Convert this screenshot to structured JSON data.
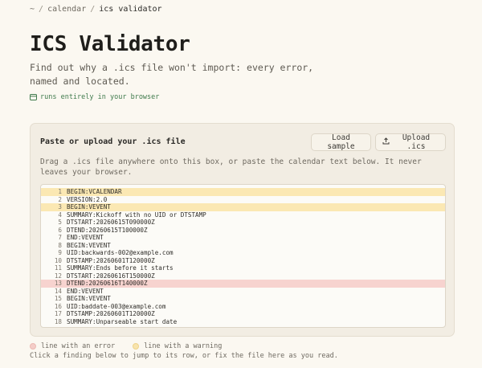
{
  "breadcrumb": {
    "home": "~",
    "section": "calendar",
    "current": "ics validator",
    "separator": "/"
  },
  "header": {
    "title": "ICS Validator",
    "subtitle": "Find out why a .ics file won't import: every error, named and located.",
    "browser_note": "runs entirely in your browser"
  },
  "panel": {
    "title": "Paste or upload your .ics file",
    "load_sample_label": "Load sample",
    "upload_label": "Upload .ics",
    "description": "Drag a .ics file anywhere onto this box, or paste the calendar text below. It never leaves your browser."
  },
  "editor": {
    "lines": [
      {
        "n": "1",
        "text": "BEGIN:VCALENDAR",
        "status": "warning"
      },
      {
        "n": "2",
        "text": "VERSION:2.0",
        "status": ""
      },
      {
        "n": "3",
        "text": "BEGIN:VEVENT",
        "status": "warning"
      },
      {
        "n": "4",
        "text": "SUMMARY:Kickoff with no UID or DTSTAMP",
        "status": ""
      },
      {
        "n": "5",
        "text": "DTSTART:20260615T090000Z",
        "status": ""
      },
      {
        "n": "6",
        "text": "DTEND:20260615T100000Z",
        "status": ""
      },
      {
        "n": "7",
        "text": "END:VEVENT",
        "status": ""
      },
      {
        "n": "8",
        "text": "BEGIN:VEVENT",
        "status": ""
      },
      {
        "n": "9",
        "text": "UID:backwards-002@example.com",
        "status": ""
      },
      {
        "n": "10",
        "text": "DTSTAMP:20260601T120000Z",
        "status": ""
      },
      {
        "n": "11",
        "text": "SUMMARY:Ends before it starts",
        "status": ""
      },
      {
        "n": "12",
        "text": "DTSTART:20260616T150000Z",
        "status": ""
      },
      {
        "n": "13",
        "text": "DTEND:20260616T140000Z",
        "status": "error"
      },
      {
        "n": "14",
        "text": "END:VEVENT",
        "status": ""
      },
      {
        "n": "15",
        "text": "BEGIN:VEVENT",
        "status": ""
      },
      {
        "n": "16",
        "text": "UID:baddate-003@example.com",
        "status": ""
      },
      {
        "n": "17",
        "text": "DTSTAMP:20260601T120000Z",
        "status": ""
      },
      {
        "n": "18",
        "text": "SUMMARY:Unparseable start date",
        "status": ""
      }
    ]
  },
  "legend": {
    "error_label": "line with an error",
    "warning_label": "line with a warning",
    "hint": "Click a finding below to jump to its row, or fix the file here as you read."
  },
  "colors": {
    "error": "#f7d3cf",
    "warning": "#fbe8b3",
    "background": "#fbf8f1",
    "accent_green": "#3f7a4c"
  },
  "icons": {
    "browser_note": "browser-window-icon",
    "upload": "upload-icon"
  }
}
